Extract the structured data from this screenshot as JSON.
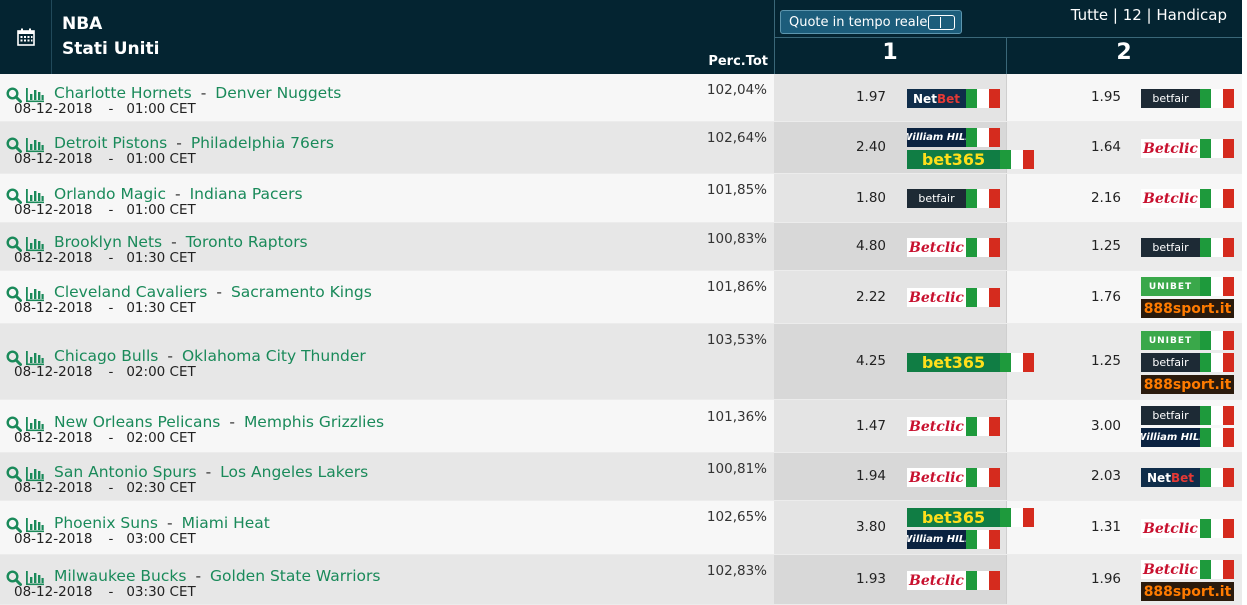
{
  "header": {
    "league": "NBA",
    "country": "Stati Uniti",
    "perc_tot_label": "Perc.Tot",
    "realtime_label": "Quote in tempo reale",
    "filters": "Tutte | 12 | Handicap",
    "col1_label": "1",
    "col2_label": "2"
  },
  "separator": "-",
  "matches": [
    {
      "home": "Charlotte Hornets",
      "away": "Denver Nuggets",
      "date": "08-12-2018",
      "time": "01:00 CET",
      "perc": "102,04%",
      "odd1": "1.97",
      "bk1": [
        {
          "name": "NetBet",
          "style": "netbet"
        }
      ],
      "odd2": "1.95",
      "bk2": [
        {
          "name": "betfair",
          "style": "betfair"
        }
      ]
    },
    {
      "home": "Detroit Pistons",
      "away": "Philadelphia 76ers",
      "date": "08-12-2018",
      "time": "01:00 CET",
      "perc": "102,64%",
      "odd1": "2.40",
      "bk1": [
        {
          "name": "William HILL",
          "style": "william"
        },
        {
          "name": "bet365",
          "style": "bet365"
        }
      ],
      "odd2": "1.64",
      "bk2": [
        {
          "name": "Betclic",
          "style": "betclic"
        }
      ]
    },
    {
      "home": "Orlando Magic",
      "away": "Indiana Pacers",
      "date": "08-12-2018",
      "time": "01:00 CET",
      "perc": "101,85%",
      "odd1": "1.80",
      "bk1": [
        {
          "name": "betfair",
          "style": "betfair"
        }
      ],
      "odd2": "2.16",
      "bk2": [
        {
          "name": "Betclic",
          "style": "betclic"
        }
      ]
    },
    {
      "home": "Brooklyn Nets",
      "away": "Toronto Raptors",
      "date": "08-12-2018",
      "time": "01:30 CET",
      "perc": "100,83%",
      "odd1": "4.80",
      "bk1": [
        {
          "name": "Betclic",
          "style": "betclic"
        }
      ],
      "odd2": "1.25",
      "bk2": [
        {
          "name": "betfair",
          "style": "betfair"
        }
      ]
    },
    {
      "home": "Cleveland Cavaliers",
      "away": "Sacramento Kings",
      "date": "08-12-2018",
      "time": "01:30 CET",
      "perc": "101,86%",
      "odd1": "2.22",
      "bk1": [
        {
          "name": "Betclic",
          "style": "betclic"
        }
      ],
      "odd2": "1.76",
      "bk2": [
        {
          "name": "UNIBET",
          "style": "unibet"
        },
        {
          "name": "888sport.it",
          "style": "888"
        }
      ]
    },
    {
      "home": "Chicago Bulls",
      "away": "Oklahoma City Thunder",
      "date": "08-12-2018",
      "time": "02:00 CET",
      "perc": "103,53%",
      "odd1": "4.25",
      "bk1": [
        {
          "name": "bet365",
          "style": "bet365"
        }
      ],
      "odd2": "1.25",
      "bk2": [
        {
          "name": "UNIBET",
          "style": "unibet"
        },
        {
          "name": "betfair",
          "style": "betfair"
        },
        {
          "name": "888sport.it",
          "style": "888"
        }
      ]
    },
    {
      "home": "New Orleans Pelicans",
      "away": "Memphis Grizzlies",
      "date": "08-12-2018",
      "time": "02:00 CET",
      "perc": "101,36%",
      "odd1": "1.47",
      "bk1": [
        {
          "name": "Betclic",
          "style": "betclic"
        }
      ],
      "odd2": "3.00",
      "bk2": [
        {
          "name": "betfair",
          "style": "betfair"
        },
        {
          "name": "William HILL",
          "style": "william"
        }
      ]
    },
    {
      "home": "San Antonio Spurs",
      "away": "Los Angeles Lakers",
      "date": "08-12-2018",
      "time": "02:30 CET",
      "perc": "100,81%",
      "odd1": "1.94",
      "bk1": [
        {
          "name": "Betclic",
          "style": "betclic"
        }
      ],
      "odd2": "2.03",
      "bk2": [
        {
          "name": "NetBet",
          "style": "netbet"
        }
      ]
    },
    {
      "home": "Phoenix Suns",
      "away": "Miami Heat",
      "date": "08-12-2018",
      "time": "03:00 CET",
      "perc": "102,65%",
      "odd1": "3.80",
      "bk1": [
        {
          "name": "bet365",
          "style": "bet365"
        },
        {
          "name": "William HILL",
          "style": "william"
        }
      ],
      "odd2": "1.31",
      "bk2": [
        {
          "name": "Betclic",
          "style": "betclic"
        }
      ]
    },
    {
      "home": "Milwaukee Bucks",
      "away": "Golden State Warriors",
      "date": "08-12-2018",
      "time": "03:30 CET",
      "perc": "102,83%",
      "odd1": "1.93",
      "bk1": [
        {
          "name": "Betclic",
          "style": "betclic"
        }
      ],
      "odd2": "1.96",
      "bk2": [
        {
          "name": "Betclic",
          "style": "betclic"
        },
        {
          "name": "888sport.it",
          "style": "888"
        }
      ]
    }
  ],
  "colors": {
    "header_bg": "#042431",
    "team_link": "#1a8a5a",
    "button_bg": "#1c5d7b"
  }
}
